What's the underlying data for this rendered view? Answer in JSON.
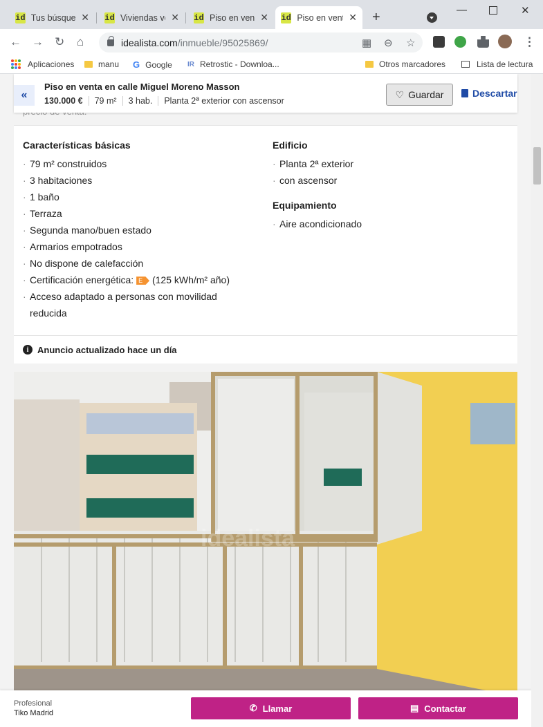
{
  "browser": {
    "tabs": [
      {
        "title": "Tus búsqued",
        "active": false
      },
      {
        "title": "Viviendas ve",
        "active": false
      },
      {
        "title": "Piso en vent",
        "active": false
      },
      {
        "title": "Piso en vent",
        "active": true
      }
    ],
    "favicon_text": "id",
    "new_tab": "+",
    "url_host": "idealista.com",
    "url_path": "/inmueble/95025869/",
    "bookmarks": [
      {
        "label": "Aplicaciones",
        "icon": "apps-grid-icon"
      },
      {
        "label": "manu",
        "icon": "folder-icon"
      },
      {
        "label": "Google",
        "icon": "google-icon"
      },
      {
        "label": "Retrostic - Downloa...",
        "icon": "retrostic-icon"
      },
      {
        "label": "Otros marcadores",
        "icon": "folder-icon"
      },
      {
        "label": "Lista de lectura",
        "icon": "reading-list-icon"
      }
    ]
  },
  "background_text": "precio de venta.",
  "sticky_header": {
    "title": "Piso en venta en calle Miguel Moreno Masson",
    "price": "130.000 €",
    "size": "79 m²",
    "rooms": "3 hab.",
    "floor": "Planta 2ª exterior con ascensor",
    "save_label": "Guardar",
    "discard_label": "Descartar"
  },
  "features": {
    "basic_title": "Características básicas",
    "basic": [
      "79 m² construidos",
      "3 habitaciones",
      "1 baño",
      "Terraza",
      "Segunda mano/buen estado",
      "Armarios empotrados",
      "No dispone de calefacción"
    ],
    "energy_label": "Certificación energética:",
    "energy_rating": "E",
    "energy_value": "(125 kWh/m² año)",
    "accessibility_line1": "Acceso adaptado a personas con movilidad",
    "accessibility_line2": "reducida",
    "building_title": "Edificio",
    "building": [
      "Planta 2ª exterior",
      "con ascensor"
    ],
    "equipment_title": "Equipamiento",
    "equipment": [
      "Aire acondicionado"
    ]
  },
  "updated_text": "Anuncio actualizado hace un día",
  "watermark": "idealista",
  "footer": {
    "type": "Profesional",
    "agency": "Tiko Madrid",
    "call_label": "Llamar",
    "contact_label": "Contactar"
  },
  "colors": {
    "brand_blue": "#1f4ba6",
    "cta_magenta": "#bf2286",
    "favicon_green": "#d8e645",
    "energy_orange": "#f59331"
  }
}
